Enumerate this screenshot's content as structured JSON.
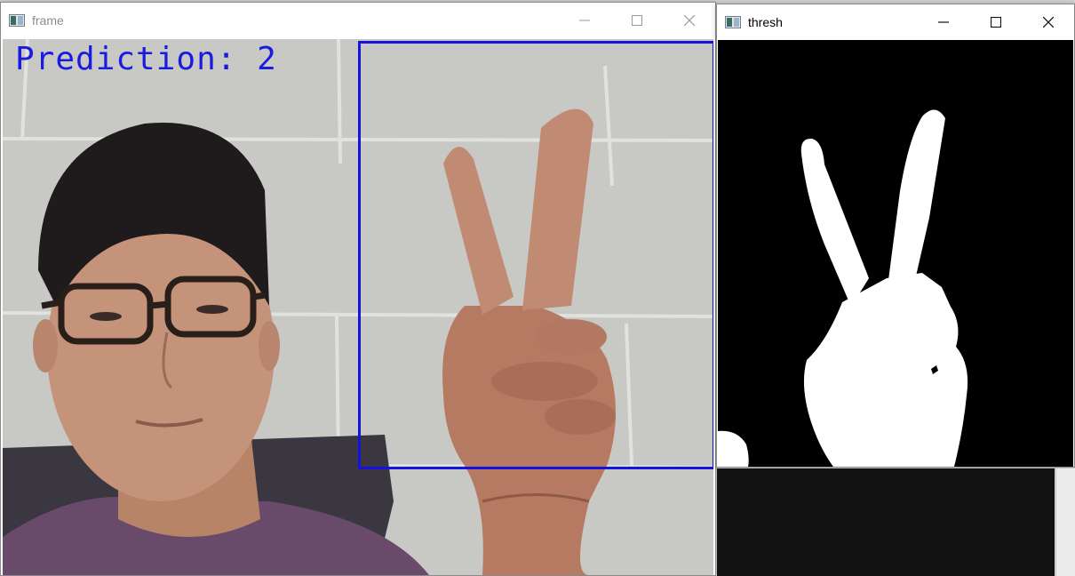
{
  "frame_window": {
    "title": "frame",
    "state": "inactive",
    "overlay_text": "Prediction: 2",
    "overlay_color": "#1a1ae0",
    "roi_color": "#1414dc",
    "icons": [
      "window-app-icon",
      "minimize-icon",
      "maximize-icon",
      "close-icon"
    ]
  },
  "thresh_window": {
    "title": "thresh",
    "state": "active",
    "icons": [
      "window-app-icon",
      "minimize-icon",
      "maximize-icon",
      "close-icon"
    ]
  }
}
